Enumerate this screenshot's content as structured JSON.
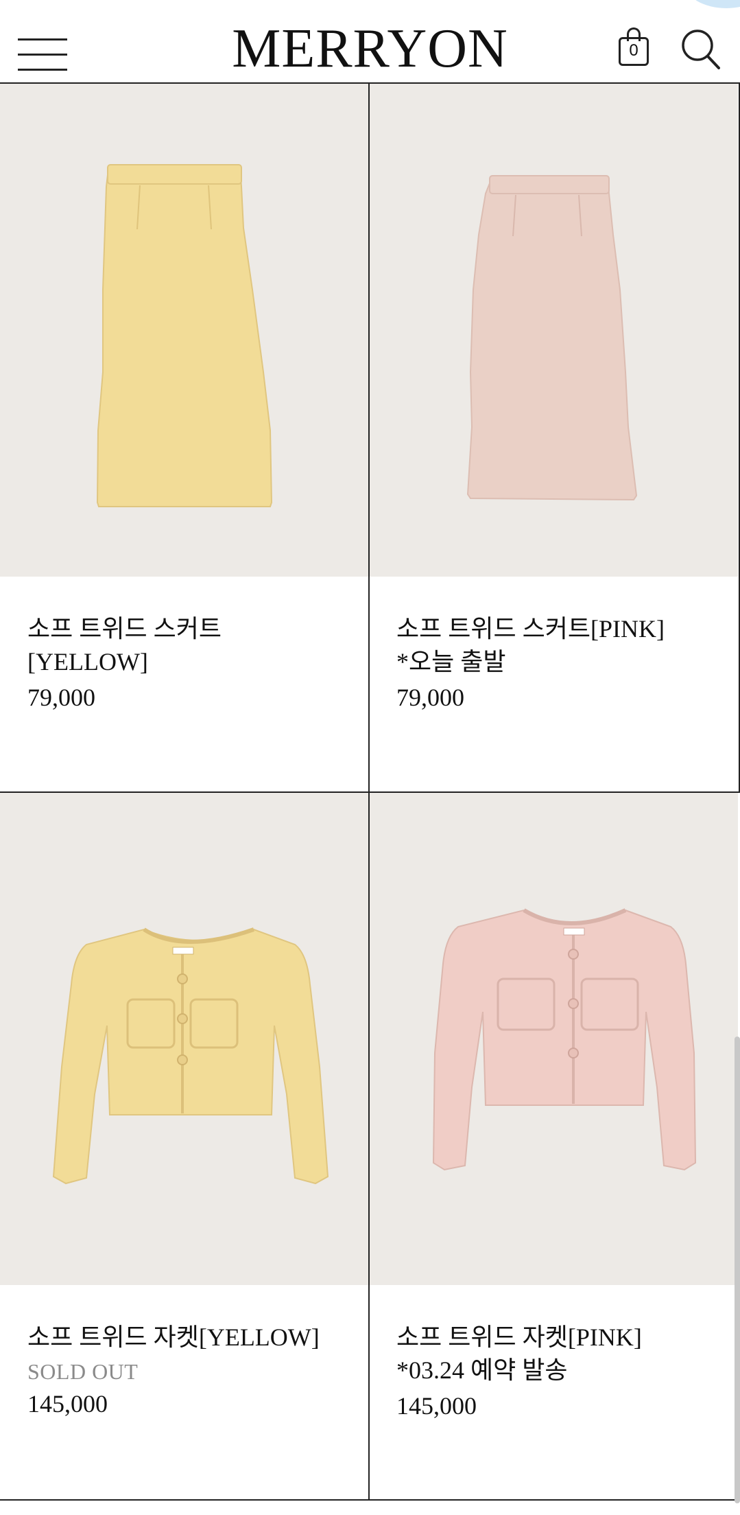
{
  "header": {
    "logo": "MERRYON",
    "cart_count": "0"
  },
  "products": [
    {
      "name": "소프 트위드 스커트[YELLOW]",
      "note": "",
      "status": "",
      "price": "79,000",
      "color": "#f2dc97",
      "kind": "skirt"
    },
    {
      "name": "소프 트위드 스커트[PINK]",
      "note": "*오늘 출발",
      "status": "",
      "price": "79,000",
      "color": "#ead0c6",
      "kind": "skirt"
    },
    {
      "name": "소프 트위드 자켓[YELLOW]",
      "note": "",
      "status": "SOLD OUT",
      "price": "145,000",
      "color": "#f2dc97",
      "kind": "jacket"
    },
    {
      "name": "소프 트위드 자켓[PINK]",
      "note": "*03.24 예약 발송",
      "status": "",
      "price": "145,000",
      "color": "#f0cdc6",
      "kind": "jacket"
    }
  ]
}
